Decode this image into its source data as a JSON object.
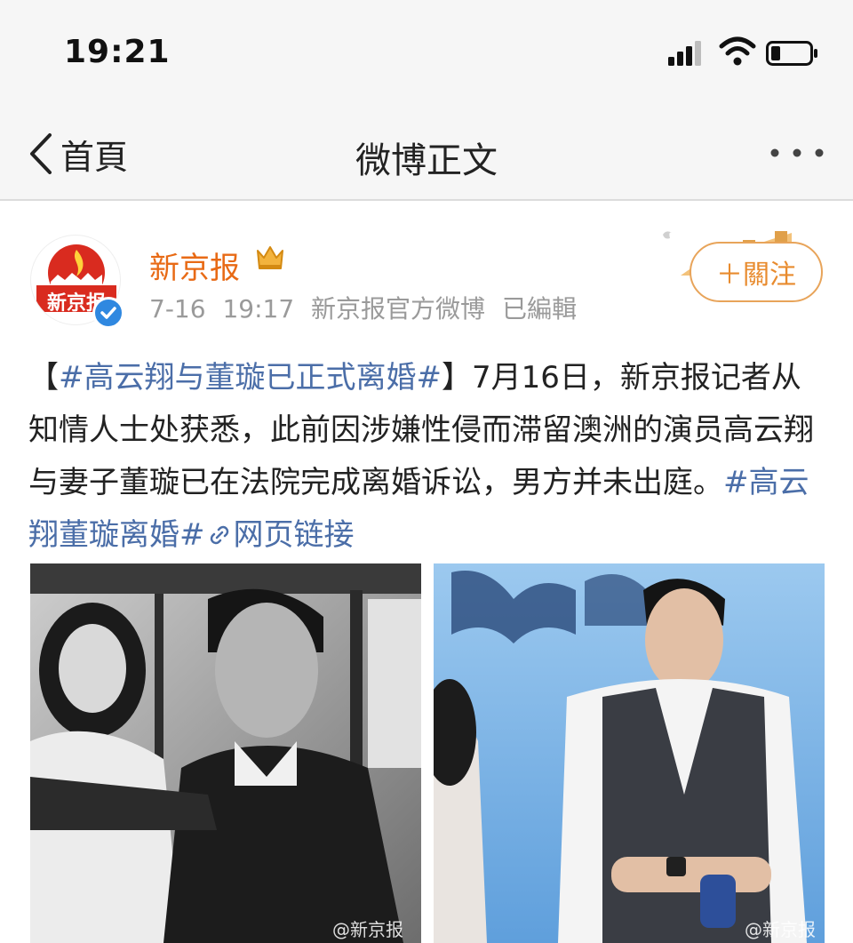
{
  "status_bar": {
    "time": "19:21"
  },
  "nav": {
    "back_label": "首頁",
    "title": "微博正文"
  },
  "post": {
    "avatar_text": "新京报",
    "username": "新京报",
    "meta": "7-16 19:17  新京报官方微博  已編輯",
    "follow_label": "＋關注",
    "text": {
      "tag_open": "【",
      "hashtag1": "#高云翔与董璇已正式离婚#",
      "tag_close": "】",
      "body": "7月16日，新京报记者从知情人士处获悉，此前因涉嫌性侵而滞留澳洲的演员高云翔与妻子董璇已在法院完成离婚诉讼，男方并未出庭。",
      "hashtag2": "#高云翔董璇离婚#",
      "link_label": "网页链接"
    },
    "photos": [
      {
        "watermark": "@新京报"
      },
      {
        "watermark": "@新京报"
      }
    ]
  },
  "colors": {
    "accent_orange": "#e86a15",
    "link_blue": "#4b6ea8",
    "follow_border": "#e8a45a"
  },
  "icons": [
    "back-arrow-icon",
    "more-icon",
    "signal-icon",
    "wifi-icon",
    "battery-icon",
    "verified-icon",
    "crown-vip-icon",
    "link-icon"
  ]
}
